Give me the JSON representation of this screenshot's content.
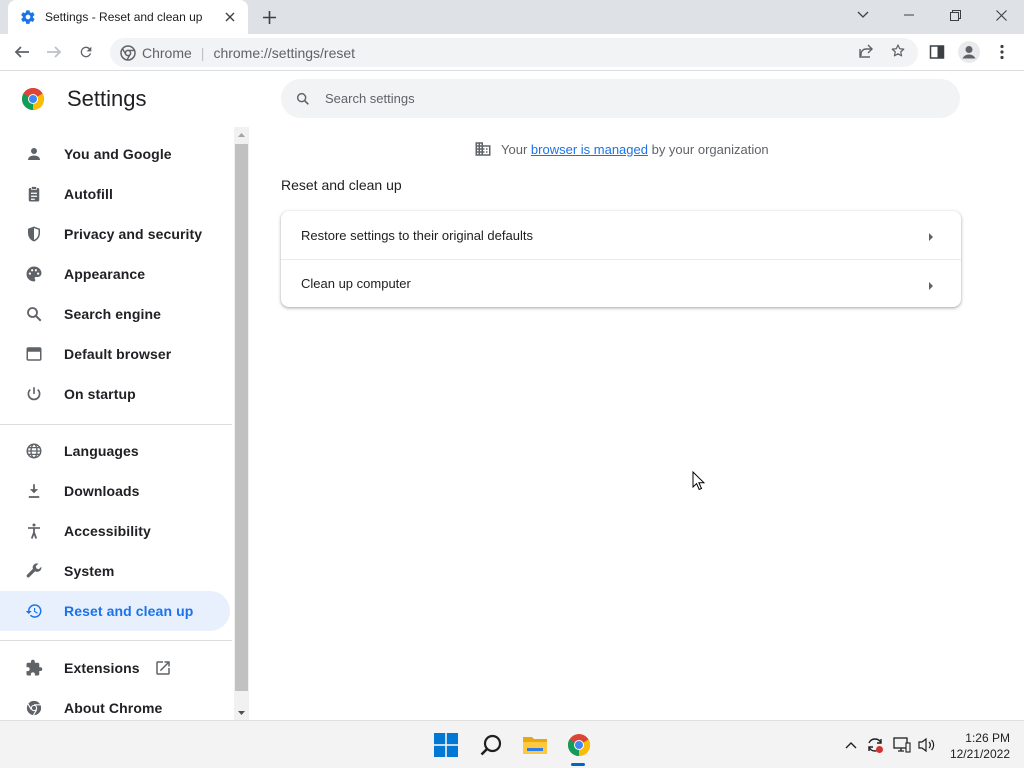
{
  "browser": {
    "tab_title": "Settings - Reset and clean up",
    "omnibox": {
      "chip": "Chrome",
      "url_scheme": "chrome://",
      "url_path": "settings/reset"
    }
  },
  "settings": {
    "title": "Settings",
    "search_placeholder": "Search settings"
  },
  "sidebar": {
    "items": [
      {
        "label": "You and Google",
        "icon": "person-icon"
      },
      {
        "label": "Autofill",
        "icon": "clipboard-icon"
      },
      {
        "label": "Privacy and security",
        "icon": "shield-icon"
      },
      {
        "label": "Appearance",
        "icon": "palette-icon"
      },
      {
        "label": "Search engine",
        "icon": "search-icon"
      },
      {
        "label": "Default browser",
        "icon": "browser-window-icon"
      },
      {
        "label": "On startup",
        "icon": "power-icon"
      },
      {
        "label": "Languages",
        "icon": "globe-icon"
      },
      {
        "label": "Downloads",
        "icon": "download-icon"
      },
      {
        "label": "Accessibility",
        "icon": "accessibility-icon"
      },
      {
        "label": "System",
        "icon": "wrench-icon"
      },
      {
        "label": "Reset and clean up",
        "icon": "history-icon",
        "active": true
      },
      {
        "label": "Extensions",
        "icon": "puzzle-icon"
      },
      {
        "label": "About Chrome",
        "icon": "chrome-icon"
      }
    ]
  },
  "main": {
    "managed": {
      "prefix": "Your",
      "link": "browser is managed",
      "suffix": "by your organization"
    },
    "section_title": "Reset and clean up",
    "rows": [
      {
        "label": "Restore settings to their original defaults"
      },
      {
        "label": "Clean up computer"
      }
    ]
  },
  "taskbar": {
    "time": "1:26 PM",
    "date": "12/21/2022"
  },
  "colors": {
    "accent": "#1a73e8",
    "active_nav_bg": "#e8f0fe",
    "tabstrip_bg": "#dee1e6"
  }
}
